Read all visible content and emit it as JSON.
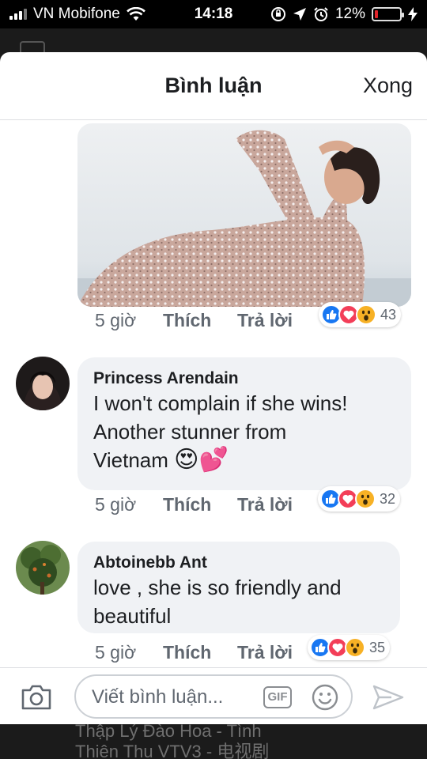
{
  "status_bar": {
    "carrier": "VN Mobifone",
    "time": "14:18",
    "battery_percent": "12%",
    "battery_level": 0.12
  },
  "header": {
    "title": "Bình luận",
    "done_label": "Xong"
  },
  "comments": [
    {
      "time": "5 giờ",
      "like_label": "Thích",
      "reply_label": "Trả lời",
      "reaction_count": "43"
    },
    {
      "author": "Princess Arendain",
      "text_lines": [
        "I won't complain if she wins!",
        "Another stunner from",
        "Vietnam"
      ],
      "emojis": [
        "😍",
        "💕"
      ],
      "time": "5 giờ",
      "like_label": "Thích",
      "reply_label": "Trả lời",
      "reaction_count": "32"
    },
    {
      "author": "Abtoinebb Ant",
      "text_lines": [
        "love , she is so friendly and",
        "beautiful"
      ],
      "time": "5 giờ",
      "like_label": "Thích",
      "reply_label": "Trả lời",
      "reaction_count": "35"
    }
  ],
  "composer": {
    "placeholder": "Viết bình luận...",
    "gif_label": "GIF"
  },
  "background_text": {
    "line1": "Thập Lý Đào Hoa - Tình",
    "line2": "Thiên Thu VTV3 - 电视剧"
  },
  "icons": {
    "status_bar": [
      "signal-icon",
      "wifi-icon",
      "rotation-lock-icon",
      "location-icon",
      "alarm-icon",
      "battery-icon",
      "charging-icon"
    ],
    "reactions": [
      "like-reaction-icon",
      "love-reaction-icon",
      "wow-reaction-icon"
    ],
    "composer": [
      "camera-icon",
      "gif-icon",
      "emoji-icon",
      "send-icon"
    ]
  },
  "colors": {
    "accent": "#1877f2",
    "love": "#f33e58",
    "wow": "#f7b125",
    "battery_low": "#e0242a",
    "bubble": "#f0f2f5"
  }
}
